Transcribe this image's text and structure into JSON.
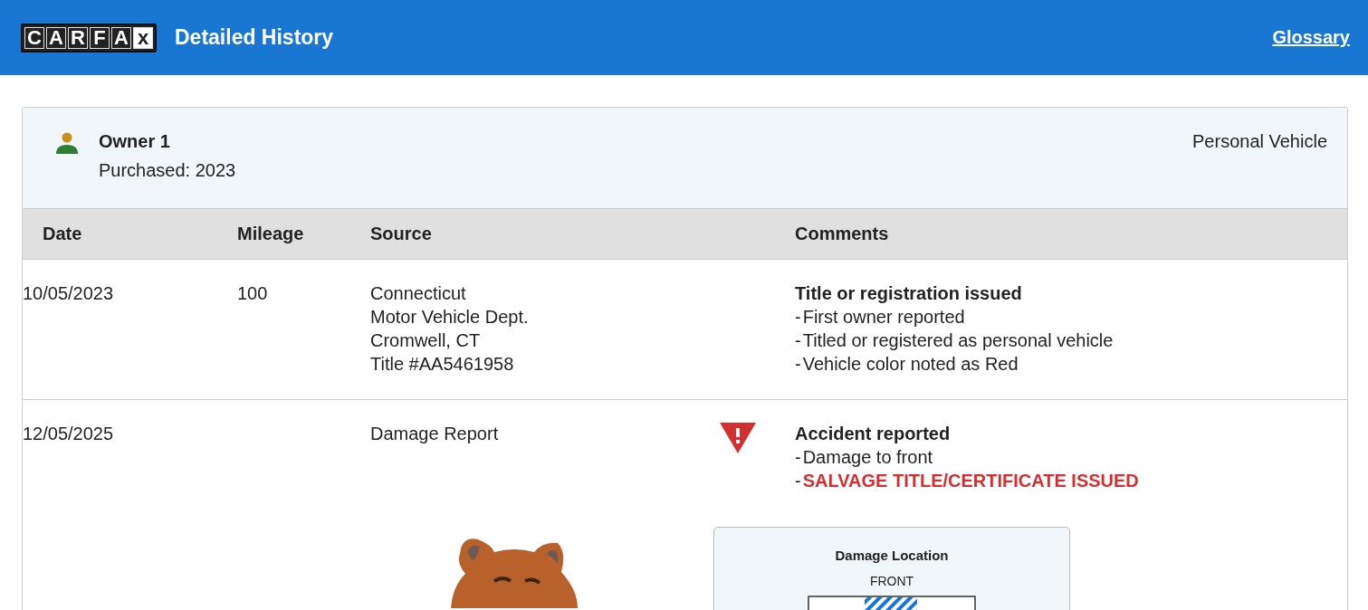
{
  "header": {
    "logo_letters": [
      "C",
      "A",
      "R",
      "F",
      "A",
      "x"
    ],
    "title": "Detailed History",
    "glossary_link": "Glossary"
  },
  "owner": {
    "name": "Owner 1",
    "purchased": "Purchased: 2023",
    "vehicle_type": "Personal Vehicle"
  },
  "table": {
    "columns": [
      "Date",
      "Mileage",
      "Source",
      "",
      "Comments"
    ],
    "rows": [
      {
        "date": "10/05/2023",
        "mileage": "100",
        "source": [
          "Connecticut",
          "Motor Vehicle Dept.",
          "Cromwell, CT",
          "Title #AA5461958"
        ],
        "alert": false,
        "comment_title": "Title or registration issued",
        "comment_items": [
          {
            "marker": "-",
            "text": "First owner reported",
            "kind": "normal"
          },
          {
            "marker": "-",
            "text": "Titled or registered as personal vehicle",
            "kind": "normal"
          },
          {
            "marker": "-",
            "text": "Vehicle color noted as Red",
            "kind": "normal"
          }
        ]
      },
      {
        "date": "12/05/2025",
        "mileage": "",
        "source": [
          "Damage Report"
        ],
        "alert": true,
        "comment_title": "Accident reported",
        "comment_items": [
          {
            "marker": "-",
            "text": "Damage to front",
            "kind": "normal"
          },
          {
            "marker": "-",
            "text": "SALVAGE TITLE/CERTIFICATE ISSUED",
            "kind": "alert"
          }
        ],
        "damage": {
          "title": "Damage Location",
          "side": "FRONT"
        }
      }
    ]
  }
}
